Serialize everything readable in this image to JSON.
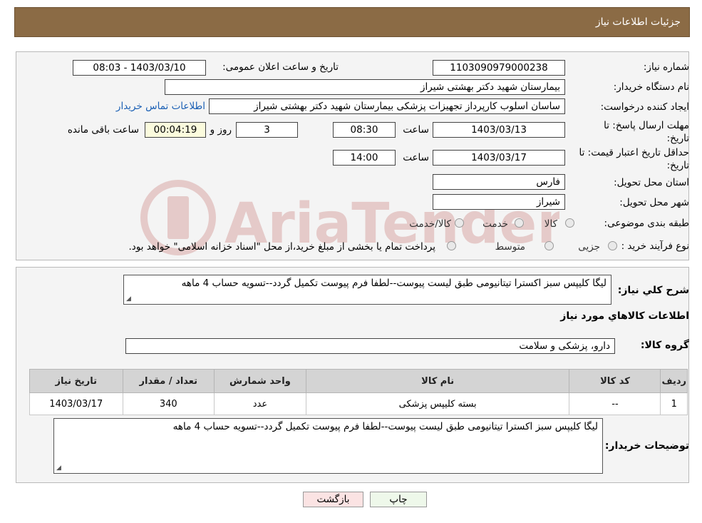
{
  "header": {
    "title": "جزئیات اطلاعات نیاز"
  },
  "form": {
    "need_number": {
      "label": "شماره نیاز:",
      "value": "1103090979000238"
    },
    "announce_datetime": {
      "label": "تاریخ و ساعت اعلان عمومی:",
      "value": "1403/03/10 - 08:03"
    },
    "buyer_org": {
      "label": "نام دستگاه خریدار:",
      "value": "بیمارستان شهید دکتر بهشتی شیراز"
    },
    "requester": {
      "label": "ایجاد کننده درخواست:",
      "value": "ساسان اسلوب کارپرداز  تجهیزات پزشکی بیمارستان شهید دکتر بهشتی شیراز",
      "contact_link": "اطلاعات تماس خریدار"
    },
    "reply_deadline": {
      "label_line1": "مهلت ارسال پاسخ: تا",
      "label_line2": "تاریخ:",
      "date": "1403/03/13",
      "time_label": "ساعت",
      "time": "08:30",
      "days": "3",
      "days_label": "روز و",
      "remaining": "00:04:19",
      "remaining_label": "ساعت باقی مانده"
    },
    "price_validity": {
      "label_line1": "حداقل تاریخ اعتبار قیمت: تا",
      "label_line2": "تاریخ:",
      "date": "1403/03/17",
      "time_label": "ساعت",
      "time": "14:00"
    },
    "province": {
      "label": "استان محل تحویل:",
      "value": "فارس"
    },
    "city": {
      "label": "شهر محل تحویل:",
      "value": "شیراز"
    },
    "category": {
      "label": "طبقه بندی موضوعی:",
      "options": [
        "کالا",
        "خدمت",
        "کالا/خدمت"
      ]
    },
    "process": {
      "label": "نوع فرآیند خرید :",
      "options": [
        "جزیی",
        "متوسط"
      ],
      "note": "پرداخت تمام یا بخشی از مبلغ خرید،از محل \"اسناد خزانه اسلامی\" خواهد بود."
    }
  },
  "details": {
    "summary_label": "شرح کلي نياز:",
    "summary_value": "لیگا کلیپس سبز اکسترا تیتانیومی طبق لیست پیوست--لطفا فرم پیوست تکمیل گردد--تسویه حساب 4 ماهه",
    "goods_info_title": "اطلاعات کالاهاي مورد نياز",
    "goods_group_label": "گروه کالا:",
    "goods_group_value": "دارو، پزشکی و سلامت",
    "table": {
      "headers": [
        "ردیف",
        "کد کالا",
        "نام کالا",
        "واحد شمارش",
        "تعداد / مقدار",
        "تاریخ نیاز"
      ],
      "rows": [
        [
          "1",
          "--",
          "بسته کلیپس پزشکی",
          "عدد",
          "340",
          "1403/03/17"
        ]
      ]
    },
    "buyer_notes_label": "توضیحات خریدار:",
    "buyer_notes_value": "لیگا کلیپس سبز اکسترا تیتانیومی طبق لیست پیوست--لطفا فرم پیوست تکمیل گردد--تسویه حساب 4 ماهه"
  },
  "buttons": {
    "print": "چاپ",
    "back": "بازگشت"
  },
  "watermark": {
    "text": "AriaTender.neT",
    "color": "#d9a9a6"
  }
}
